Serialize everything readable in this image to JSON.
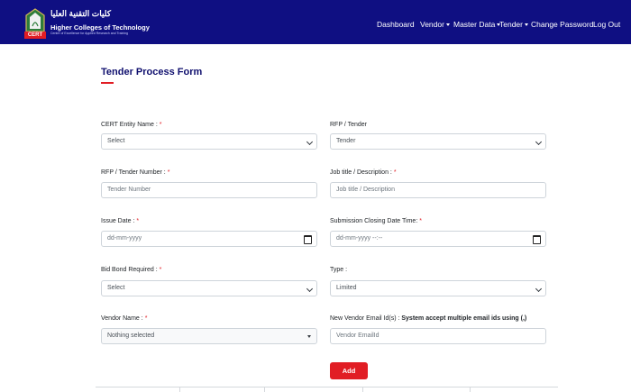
{
  "brand": {
    "arabic": "كليات التقنية العليا",
    "name": "Higher Colleges of Technology",
    "subtitle": "Centre of Excellence for Applied Research and Training",
    "tag": "CERT"
  },
  "nav": {
    "dashboard": "Dashboard",
    "vendor": "Vendor",
    "master_data": "Master Data",
    "tender": "Tender",
    "change_password": "Change Password",
    "logout": "Log Out"
  },
  "form": {
    "title": "Tender Process Form",
    "required_mark": "*",
    "fields": {
      "entity": {
        "label": "CERT Entity Name :",
        "value": "Select"
      },
      "rfp_type": {
        "label": "RFP / Tender",
        "value": "Tender"
      },
      "rfp_number": {
        "label": "RFP / Tender Number :",
        "placeholder": "Tender Number"
      },
      "job_title": {
        "label": "Job title / Description :",
        "placeholder": "Job title / Description"
      },
      "issue_date": {
        "label": "Issue Date :",
        "placeholder": "dd-mm-yyyy"
      },
      "closing": {
        "label": "Submission Closing Date Time:",
        "placeholder": "dd-mm-yyyy --:--"
      },
      "bid_bond": {
        "label": "Bid Bond Required :",
        "value": "Select"
      },
      "type": {
        "label": "Type :",
        "value": "Limited"
      },
      "vendor": {
        "label": "Vendor Name :",
        "value": "Nothing selected"
      },
      "new_email": {
        "label": "New Vendor Email Id(s) :",
        "note": "System accept multiple email ids using (,)",
        "placeholder": "Vendor EmailId"
      }
    },
    "add_button": "Add"
  },
  "colors": {
    "navbar": "#0f0f82",
    "accent": "#e11d24",
    "title": "#0f0f6e"
  }
}
